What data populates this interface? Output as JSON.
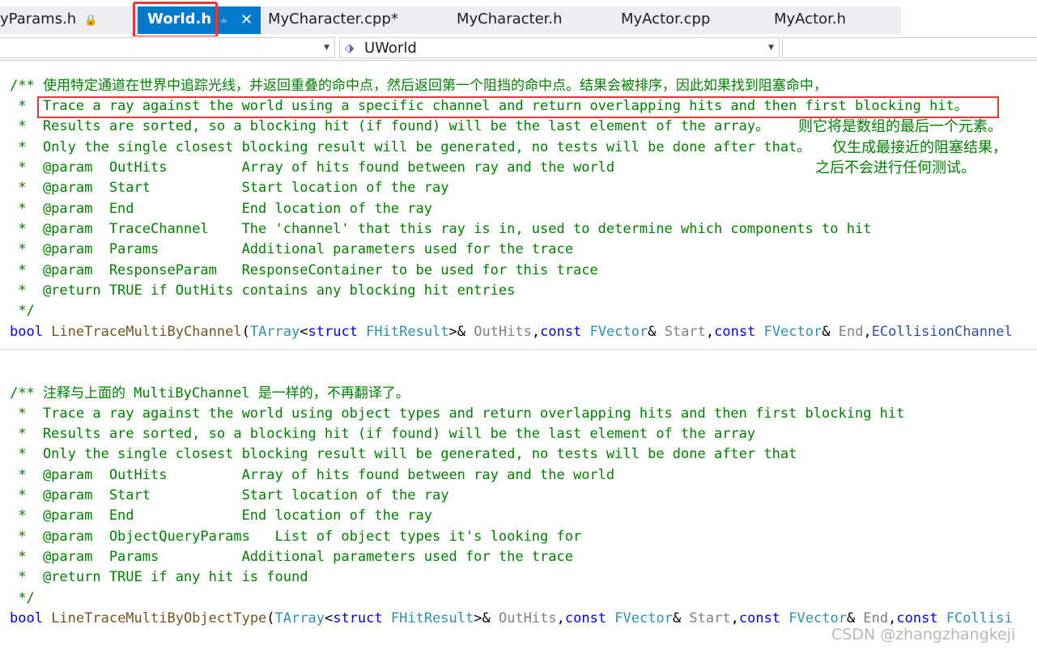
{
  "tabs": {
    "t0": "yParams.h",
    "active": "World.h",
    "t2": "MyCharacter.cpp*",
    "t3": "MyCharacter.h",
    "t4": "MyActor.cpp",
    "t5": "MyActor.h",
    "pin_glyph": "⊣",
    "close_glyph": "✕",
    "lock_glyph": "🔒"
  },
  "nav": {
    "scope_value": "UWorld",
    "scope_icon": "class-icon"
  },
  "block1": {
    "l1": "/** 使用特定通道在世界中追踪光线，并返回重叠的命中点，然后返回第一个阻挡的命中点。结果会被排序，因此如果找到阻塞命中，",
    "l2": " *  Trace a ray against the world using a specific channel and return overlapping hits and then first blocking hit。",
    "l3": " *  Results are sorted, so a blocking hit (if found) will be the last element of the array。",
    "l3cn": "则它将是数组的最后一个元素。",
    "l4": " *  Only the single closest blocking result will be generated, no tests will be done after that。",
    "l4cn": "仅生成最接近的阻塞结果，",
    "l5": " *  @param  OutHits         Array of hits found between ray and the world",
    "l5cn": "之后不会进行任何测试。",
    "l6": " *  @param  Start           Start location of the ray",
    "l7": " *  @param  End             End location of the ray",
    "l8": " *  @param  TraceChannel    The 'channel' that this ray is in, used to determine which components to hit",
    "l9": " *  @param  Params          Additional parameters used for the trace",
    "l10": " *  @param  ResponseParam   ResponseContainer to be used for this trace",
    "l11": " *  @return TRUE if OutHits contains any blocking hit entries",
    "l12": " */",
    "sig": {
      "k1": "bool",
      "f": " LineTraceMultiByChannel",
      "p1": "(",
      "t1": "TArray",
      "p2": "<",
      "k2": "struct",
      "t2": " FHitResult",
      "p3": ">& ",
      "a1": "OutHits",
      "p4": ",",
      "k3": "const",
      "t3": " FVector",
      "p5": "& ",
      "a2": "Start",
      "p6": ",",
      "k4": "const",
      "t4": " FVector",
      "p7": "& ",
      "a3": "End",
      "p8": ",",
      "t5": "ECollisionChannel"
    }
  },
  "block2": {
    "l1": "/** 注释与上面的 MultiByChannel 是一样的，不再翻译了。",
    "l2": " *  Trace a ray against the world using object types and return overlapping hits and then first blocking hit",
    "l3": " *  Results are sorted, so a blocking hit (if found) will be the last element of the array",
    "l4": " *  Only the single closest blocking result will be generated, no tests will be done after that",
    "l5": " *  @param  OutHits         Array of hits found between ray and the world",
    "l6": " *  @param  Start           Start location of the ray",
    "l7": " *  @param  End             End location of the ray",
    "l8": " *  @param  ObjectQueryParams   List of object types it's looking for",
    "l9": " *  @param  Params          Additional parameters used for the trace",
    "l10": " *  @return TRUE if any hit is found",
    "l11": " */",
    "sig": {
      "k1": "bool",
      "f": " LineTraceMultiByObjectType",
      "p1": "(",
      "t1": "TArray",
      "p2": "<",
      "k2": "struct",
      "t2": " FHitResult",
      "p3": ">& ",
      "a1": "OutHits",
      "p4": ",",
      "k3": "const",
      "t3": " FVector",
      "p5": "& ",
      "a2": "Start",
      "p6": ",",
      "k4": "const",
      "t4": " FVector",
      "p7": "& ",
      "a3": "End",
      "p8": ",",
      "k5": "const",
      "t5": " FCollisi"
    }
  },
  "watermark": "CSDN @zhangzhangkeji",
  "colors": {
    "comment": "#008000",
    "keyword": "#0000ff",
    "type": "#2b91af",
    "function": "#74531f",
    "param": "#808080",
    "accent": "#007acc",
    "highlight": "#e53935"
  }
}
